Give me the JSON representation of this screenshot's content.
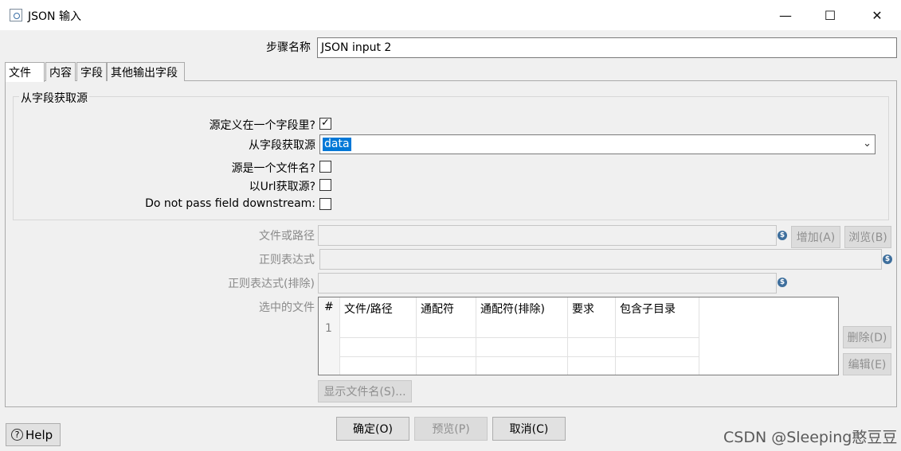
{
  "window": {
    "title": "JSON 输入",
    "minimize_glyph": "—",
    "maximize_glyph": "☐",
    "close_glyph": "✕"
  },
  "step_name": {
    "label": "步骤名称",
    "value": "JSON input 2"
  },
  "tabs": [
    {
      "label": "文件",
      "active": true
    },
    {
      "label": "内容",
      "active": false
    },
    {
      "label": "字段",
      "active": false
    },
    {
      "label": "其他输出字段",
      "active": false
    }
  ],
  "source_group": {
    "title": "从字段获取源",
    "source_in_field_label": "源定义在一个字段里?",
    "source_in_field_checked": true,
    "get_from_field_label": "从字段获取源",
    "get_from_field_value": "data",
    "source_is_filename_label": "源是一个文件名?",
    "source_is_filename_checked": false,
    "read_url_label": "以Url获取源?",
    "read_url_checked": false,
    "do_not_pass_label": "Do not pass field downstream:",
    "do_not_pass_checked": false
  },
  "file": {
    "file_or_dir_label": "文件或路径",
    "add_button": "增加(A)",
    "browse_button": "浏览(B)",
    "regex_label": "正则表达式",
    "regex_exclude_label": "正则表达式(排除)",
    "selected_files_label": "选中的文件",
    "table_headers": [
      "#",
      "文件/路径",
      "通配符",
      "通配符(排除)",
      "要求",
      "包含子目录"
    ],
    "table_rows": [
      [
        "1",
        "",
        "",
        "",
        "",
        ""
      ]
    ],
    "delete_button": "删除(D)",
    "edit_button": "编辑(E)",
    "show_filenames_button": "显示文件名(S)..."
  },
  "footer": {
    "ok_button": "确定(O)",
    "preview_button": "预览(P)",
    "cancel_button": "取消(C)",
    "help_button": "Help"
  },
  "watermark": "CSDN @Sleeping憨豆豆",
  "colors": {
    "selection": "#0078d7",
    "variable_icon": "#3d6e9c"
  }
}
